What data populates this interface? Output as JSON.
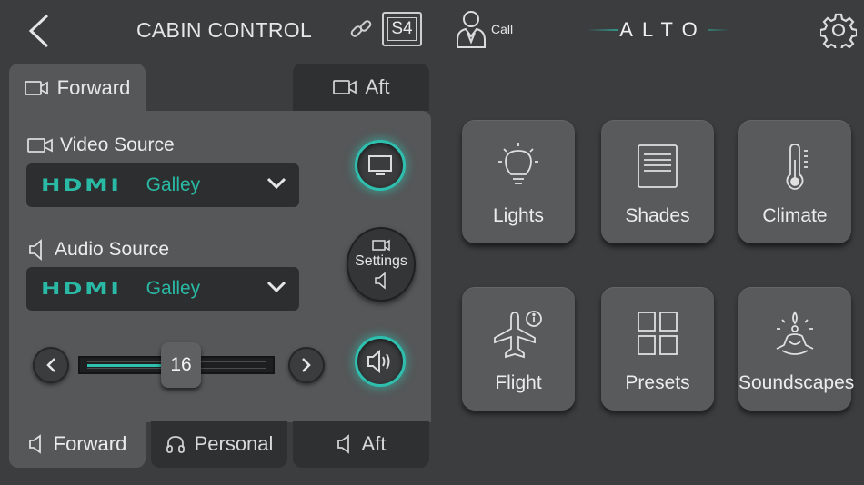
{
  "header": {
    "title": "CABIN CONTROL",
    "badge": "S4",
    "call_label": "Call",
    "logo_text": "ALTO"
  },
  "zone_tabs_top": [
    {
      "label": "Forward",
      "active": true
    },
    {
      "label": "Aft",
      "active": false
    }
  ],
  "video": {
    "label": "Video Source",
    "source_brand": "HDMI",
    "source_value": "Galley"
  },
  "audio": {
    "label": "Audio Source",
    "source_brand": "HDMI",
    "source_value": "Galley"
  },
  "settings_button": {
    "label": "Settings"
  },
  "volume": {
    "value": "16",
    "fill_fraction": 0.4
  },
  "zone_tabs_bottom": [
    {
      "label": "Forward",
      "active": true
    },
    {
      "label": "Personal",
      "active": false
    },
    {
      "label": "Aft",
      "active": false
    }
  ],
  "tiles": [
    {
      "label": "Lights",
      "icon": "lightbulb-icon"
    },
    {
      "label": "Shades",
      "icon": "shades-icon"
    },
    {
      "label": "Climate",
      "icon": "thermometer-icon"
    },
    {
      "label": "Flight",
      "icon": "airplane-info-icon"
    },
    {
      "label": "Presets",
      "icon": "grid-icon"
    },
    {
      "label": "Soundscapes",
      "icon": "meditation-icon"
    }
  ],
  "colors": {
    "accent": "#2fbfae",
    "background": "#3b3d3e",
    "panel": "#555758",
    "tile": "#585a5b"
  }
}
